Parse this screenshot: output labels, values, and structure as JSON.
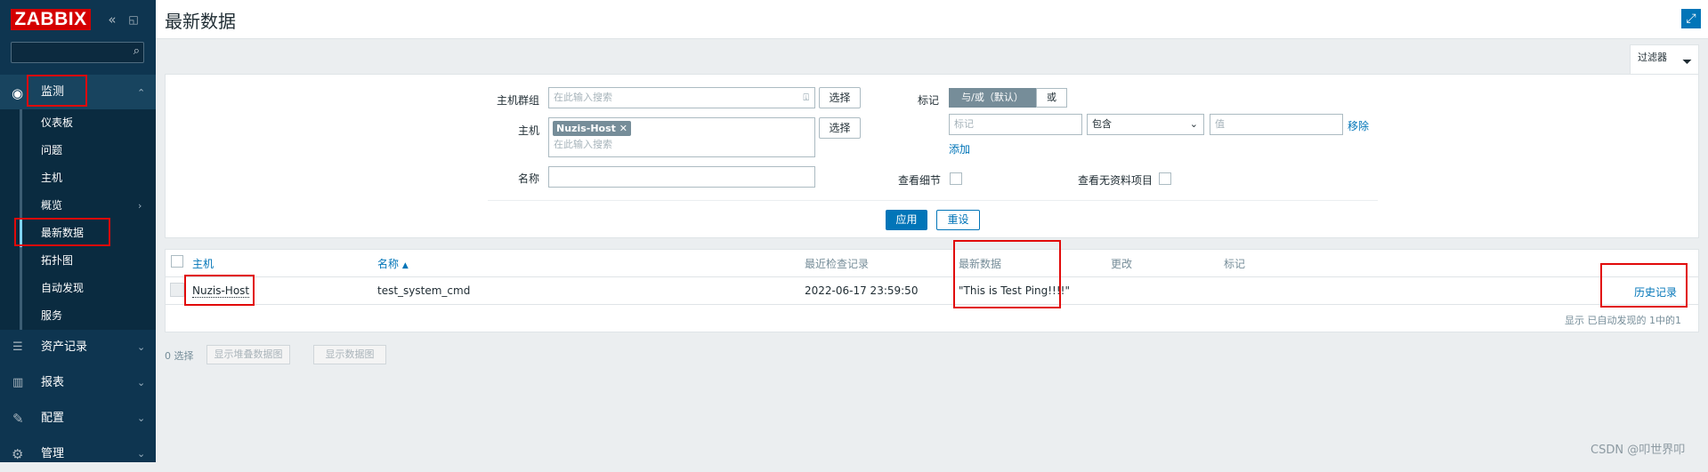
{
  "sidebar": {
    "logo": "ZABBIX",
    "menu": {
      "monitoring": "监测",
      "submenu": [
        "仪表板",
        "问题",
        "主机",
        "概览",
        "最新数据",
        "拓扑图",
        "自动发现",
        "服务"
      ],
      "assets": "资产记录",
      "reports": "报表",
      "config": "配置",
      "admin": "管理"
    }
  },
  "header": {
    "title": "最新数据"
  },
  "filter": {
    "tab_label": "过滤器",
    "host_group_label": "主机群组",
    "host_group_placeholder": "在此输入搜索",
    "select_label": "选择",
    "host_label": "主机",
    "host_chip": "Nuzis-Host",
    "host_placeholder": "在此输入搜索",
    "name_label": "名称",
    "tags_label": "标记",
    "and_or": "与/或（默认）",
    "or": "或",
    "tag_placeholder": "标记",
    "contains": "包含",
    "value_placeholder": "值",
    "remove": "移除",
    "add": "添加",
    "show_details": "查看细节",
    "show_without_data": "查看无资料项目",
    "apply": "应用",
    "reset": "重设"
  },
  "table": {
    "headers": {
      "host": "主机",
      "name": "名称",
      "last_check": "最近检查记录",
      "last_value": "最新数据",
      "change": "更改",
      "tags": "标记"
    },
    "row": {
      "host": "Nuzis-Host",
      "name": "test_system_cmd",
      "last_check": "2022-06-17 23:59:50",
      "last_value": "\"This is Test Ping!!!!\"",
      "history": "历史记录"
    },
    "summary": "显示 已自动发现的 1中的1"
  },
  "footer": {
    "selected": "0 选择",
    "stacked_graph": "显示堆叠数据图",
    "graph": "显示数据图"
  },
  "watermark": "CSDN @叩世界叩",
  "colors": {
    "sidebar": "#0e3550",
    "accent": "#0275b8",
    "highlight": "#e10a0a",
    "logo": "#d40000"
  }
}
